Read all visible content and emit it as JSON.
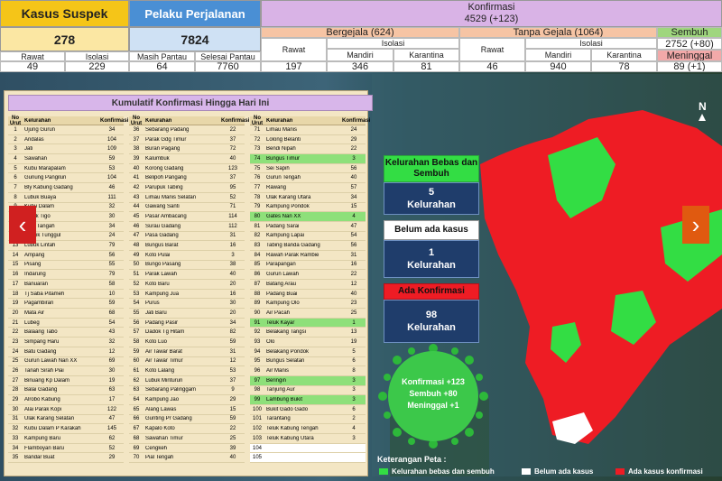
{
  "top": {
    "suspek": {
      "title": "Kasus Suspek",
      "total": "278",
      "rawat_label": "Rawat",
      "isolasi_label": "Isolasi",
      "rawat": "49",
      "isolasi": "229"
    },
    "perjalanan": {
      "title": "Pelaku Perjalanan",
      "total": "7824",
      "masih_label": "Masih Pantau",
      "selesai_label": "Selesai Pantau",
      "masih": "64",
      "selesai": "7760"
    },
    "konfirmasi": {
      "title": "Konfirmasi",
      "total": "4529 (+123)",
      "bergejala": {
        "title": "Bergejala (624)",
        "rawat_label": "Rawat",
        "isolasi_label": "Isolasi",
        "mandiri_label": "Mandiri",
        "karantina_label": "Karantina",
        "rawat": "197",
        "mandiri": "346",
        "karantina": "81"
      },
      "tanpa_gejala": {
        "title": "Tanpa Gejala (1064)",
        "rawat_label": "Rawat",
        "isolasi_label": "Isolasi",
        "mandiri_label": "Mandiri",
        "karantina_label": "Karantina",
        "rawat": "46",
        "mandiri": "940",
        "karantina": "78"
      },
      "sembuh_label": "Sembuh",
      "sembuh": "2752 (+80)",
      "meninggal_label": "Meninggal",
      "meninggal": "89 (+1)"
    }
  },
  "list": {
    "title": "Kumulatif Konfirmasi Hingga Hari Ini",
    "col_no": "No Urut",
    "col_name": "Kelurahan",
    "col_val": "Konfirmasi",
    "columns": [
      [
        {
          "no": "1",
          "name": "Ujung Gurun",
          "val": "34",
          "hl": ""
        },
        {
          "no": "2",
          "name": "Andalas",
          "val": "104",
          "hl": ""
        },
        {
          "no": "3",
          "name": "Jati",
          "val": "109",
          "hl": ""
        },
        {
          "no": "4",
          "name": "Sawahan",
          "val": "59",
          "hl": ""
        },
        {
          "no": "5",
          "name": "Kubu Marapalam",
          "val": "53",
          "hl": ""
        },
        {
          "no": "6",
          "name": "Gunung Pangilun",
          "val": "104",
          "hl": ""
        },
        {
          "no": "7",
          "name": "Bly Kabung Gadang",
          "val": "46",
          "hl": ""
        },
        {
          "no": "8",
          "name": "Lubuk Buaya",
          "val": "111",
          "hl": ""
        },
        {
          "no": "9",
          "name": "Kubu Dalam",
          "val": "32",
          "hl": ""
        },
        {
          "no": "10",
          "name": "Parak Tigo",
          "val": "30",
          "hl": ""
        },
        {
          "no": "11",
          "name": "Koto Tangah",
          "val": "34",
          "hl": ""
        },
        {
          "no": "12",
          "name": "Dadok Tunggul",
          "val": "24",
          "hl": ""
        },
        {
          "no": "13",
          "name": "Lubuk Lintah",
          "val": "79",
          "hl": ""
        },
        {
          "no": "14",
          "name": "Ampang",
          "val": "56",
          "hl": ""
        },
        {
          "no": "15",
          "name": "Pisang",
          "val": "55",
          "hl": ""
        },
        {
          "no": "16",
          "name": "Indarung",
          "val": "79",
          "hl": ""
        },
        {
          "no": "17",
          "name": "Banuaran",
          "val": "58",
          "hl": ""
        },
        {
          "no": "18",
          "name": "Tj Saba Pitameh",
          "val": "10",
          "hl": ""
        },
        {
          "no": "19",
          "name": "Pagambiran",
          "val": "59",
          "hl": ""
        },
        {
          "no": "20",
          "name": "Mata Air",
          "val": "68",
          "hl": ""
        },
        {
          "no": "21",
          "name": "Lubeg",
          "val": "54",
          "hl": ""
        },
        {
          "no": "22",
          "name": "Balaang Tabo",
          "val": "43",
          "hl": ""
        },
        {
          "no": "23",
          "name": "Simpang Haru",
          "val": "32",
          "hl": ""
        },
        {
          "no": "24",
          "name": "Batu Gadang",
          "val": "12",
          "hl": ""
        },
        {
          "no": "25",
          "name": "Gurun Lawah Nan XX",
          "val": "69",
          "hl": ""
        },
        {
          "no": "26",
          "name": "Tanah Sirah Piai",
          "val": "30",
          "hl": ""
        },
        {
          "no": "27",
          "name": "Binuang Kp Dalam",
          "val": "19",
          "hl": ""
        },
        {
          "no": "28",
          "name": "Balai Gadang",
          "val": "63",
          "hl": ""
        },
        {
          "no": "29",
          "name": "Alrobo Kabung",
          "val": "17",
          "hl": ""
        },
        {
          "no": "30",
          "name": "Alai Parak Kopi",
          "val": "122",
          "hl": ""
        },
        {
          "no": "31",
          "name": "Ulak Karang Selatan",
          "val": "47",
          "hl": ""
        },
        {
          "no": "32",
          "name": "Kubu Dalam P Karakah",
          "val": "145",
          "hl": ""
        },
        {
          "no": "33",
          "name": "Kampung Baru",
          "val": "62",
          "hl": ""
        },
        {
          "no": "34",
          "name": "Flamboyan Baru",
          "val": "52",
          "hl": ""
        },
        {
          "no": "35",
          "name": "Bandar Buat",
          "val": "29",
          "hl": ""
        }
      ],
      [
        {
          "no": "36",
          "name": "Sebarang Padang",
          "val": "22",
          "hl": ""
        },
        {
          "no": "37",
          "name": "Parak Gdg Timur",
          "val": "37",
          "hl": ""
        },
        {
          "no": "38",
          "name": "Buran Pagang",
          "val": "72",
          "hl": ""
        },
        {
          "no": "39",
          "name": "Kalumbuk",
          "val": "40",
          "hl": ""
        },
        {
          "no": "40",
          "name": "Korong Gadang",
          "val": "123",
          "hl": ""
        },
        {
          "no": "41",
          "name": "Belipoh Pangang",
          "val": "37",
          "hl": ""
        },
        {
          "no": "42",
          "name": "Parupuk Tabing",
          "val": "95",
          "hl": ""
        },
        {
          "no": "43",
          "name": "Limau Manis Selatan",
          "val": "52",
          "hl": ""
        },
        {
          "no": "44",
          "name": "Gawang Santi",
          "val": "71",
          "hl": ""
        },
        {
          "no": "45",
          "name": "Pasar Ambacang",
          "val": "114",
          "hl": ""
        },
        {
          "no": "46",
          "name": "Surau Gadang",
          "val": "112",
          "hl": ""
        },
        {
          "no": "47",
          "name": "Pasa Gadang",
          "val": "31",
          "hl": ""
        },
        {
          "no": "48",
          "name": "Bungus Barat",
          "val": "16",
          "hl": ""
        },
        {
          "no": "49",
          "name": "Koto Pulai",
          "val": "3",
          "hl": ""
        },
        {
          "no": "50",
          "name": "Bungo Pasang",
          "val": "38",
          "hl": ""
        },
        {
          "no": "51",
          "name": "Parak Lawah",
          "val": "40",
          "hl": ""
        },
        {
          "no": "52",
          "name": "Koto Baru",
          "val": "20",
          "hl": ""
        },
        {
          "no": "53",
          "name": "Kampung Jua",
          "val": "16",
          "hl": ""
        },
        {
          "no": "54",
          "name": "Purus",
          "val": "30",
          "hl": ""
        },
        {
          "no": "55",
          "name": "Jati Baru",
          "val": "20",
          "hl": ""
        },
        {
          "no": "56",
          "name": "Padang Pasir",
          "val": "34",
          "hl": ""
        },
        {
          "no": "57",
          "name": "Dadok Tg Hitam",
          "val": "82",
          "hl": ""
        },
        {
          "no": "58",
          "name": "Koto Luo",
          "val": "59",
          "hl": ""
        },
        {
          "no": "59",
          "name": "Air Tawar Barat",
          "val": "31",
          "hl": ""
        },
        {
          "no": "60",
          "name": "Air Tawar Timur",
          "val": "12",
          "hl": ""
        },
        {
          "no": "61",
          "name": "Koto Lalang",
          "val": "53",
          "hl": ""
        },
        {
          "no": "62",
          "name": "Lubuk Minturun",
          "val": "37",
          "hl": ""
        },
        {
          "no": "63",
          "name": "Sebarang Palinggam",
          "val": "9",
          "hl": ""
        },
        {
          "no": "64",
          "name": "Kampung Jao",
          "val": "29",
          "hl": ""
        },
        {
          "no": "65",
          "name": "Alang Lawas",
          "val": "15",
          "hl": ""
        },
        {
          "no": "66",
          "name": "Gunting Pr Gadang",
          "val": "59",
          "hl": ""
        },
        {
          "no": "67",
          "name": "Kapalo Koto",
          "val": "22",
          "hl": ""
        },
        {
          "no": "68",
          "name": "Sawahan Timur",
          "val": "25",
          "hl": ""
        },
        {
          "no": "69",
          "name": "Cengkeh",
          "val": "39",
          "hl": ""
        },
        {
          "no": "70",
          "name": "Pial Tengah",
          "val": "40",
          "hl": ""
        }
      ],
      [
        {
          "no": "71",
          "name": "Limau Manis",
          "val": "24",
          "hl": ""
        },
        {
          "no": "72",
          "name": "Lolong Belanti",
          "val": "29",
          "hl": ""
        },
        {
          "no": "73",
          "name": "Bendi Nipah",
          "val": "22",
          "hl": ""
        },
        {
          "no": "74",
          "name": "Bungus Timur",
          "val": "3",
          "hl": "g"
        },
        {
          "no": "75",
          "name": "Sei Sapih",
          "val": "56",
          "hl": ""
        },
        {
          "no": "76",
          "name": "Gurun Tengah",
          "val": "40",
          "hl": ""
        },
        {
          "no": "77",
          "name": "Rawang",
          "val": "57",
          "hl": ""
        },
        {
          "no": "78",
          "name": "Ulak Karang Utara",
          "val": "34",
          "hl": ""
        },
        {
          "no": "79",
          "name": "Kampung Pondok",
          "val": "15",
          "hl": ""
        },
        {
          "no": "80",
          "name": "Gates Nan XX",
          "val": "4",
          "hl": "g"
        },
        {
          "no": "81",
          "name": "Padang Sarai",
          "val": "47",
          "hl": ""
        },
        {
          "no": "82",
          "name": "Kampung Lapai",
          "val": "54",
          "hl": ""
        },
        {
          "no": "83",
          "name": "Tabing Banda Gadang",
          "val": "56",
          "hl": ""
        },
        {
          "no": "84",
          "name": "Rawah Parak Rambie",
          "val": "31",
          "hl": ""
        },
        {
          "no": "85",
          "name": "Parapangan",
          "val": "16",
          "hl": ""
        },
        {
          "no": "86",
          "name": "Gurun Lawah",
          "val": "22",
          "hl": ""
        },
        {
          "no": "87",
          "name": "Batang Arau",
          "val": "12",
          "hl": ""
        },
        {
          "no": "88",
          "name": "Padang Buai",
          "val": "40",
          "hl": ""
        },
        {
          "no": "89",
          "name": "Kampung Olo",
          "val": "23",
          "hl": ""
        },
        {
          "no": "90",
          "name": "Air Pacah",
          "val": "25",
          "hl": ""
        },
        {
          "no": "91",
          "name": "Teluk Kayar",
          "val": "1",
          "hl": "g"
        },
        {
          "no": "92",
          "name": "Belakang Tangsi",
          "val": "13",
          "hl": ""
        },
        {
          "no": "93",
          "name": "Olo",
          "val": "19",
          "hl": ""
        },
        {
          "no": "94",
          "name": "Belakang Pondok",
          "val": "5",
          "hl": ""
        },
        {
          "no": "95",
          "name": "Bungus Selatan",
          "val": "6",
          "hl": ""
        },
        {
          "no": "96",
          "name": "Air Manis",
          "val": "8",
          "hl": ""
        },
        {
          "no": "97",
          "name": "Beringin",
          "val": "3",
          "hl": "g"
        },
        {
          "no": "98",
          "name": "Tanjung Aur",
          "val": "3",
          "hl": ""
        },
        {
          "no": "99",
          "name": "Lambung Bukit",
          "val": "3",
          "hl": "g"
        },
        {
          "no": "100",
          "name": "Bukit Gado Gado",
          "val": "6",
          "hl": ""
        },
        {
          "no": "101",
          "name": "Tarantang",
          "val": "2",
          "hl": ""
        },
        {
          "no": "102",
          "name": "Teluk Kabung Tengah",
          "val": "4",
          "hl": ""
        },
        {
          "no": "103",
          "name": "Teluk Kabung Utara",
          "val": "3",
          "hl": ""
        },
        {
          "no": "104",
          "name": "",
          "val": "",
          "hl": "w"
        },
        {
          "no": "105",
          "name": "",
          "val": "",
          "hl": "w"
        }
      ]
    ]
  },
  "map": {
    "box1_title": "Kelurahan Bebas dan Sembuh",
    "box1_num": "5",
    "box1_unit": "Kelurahan",
    "box2_title": "Belum ada kasus",
    "box2_num": "1",
    "box2_unit": "Kelurahan",
    "box3_title": "Ada Konfirmasi",
    "box3_num": "98",
    "box3_unit": "Kelurahan",
    "virus_line1": "Konfirmasi +123",
    "virus_line2": "Sembuh +80",
    "virus_line3": "Meninggal +1",
    "north": "N",
    "legend_title": "Keterangan Peta :",
    "legend_green": "Kelurahan bebas dan sembuh",
    "legend_white": "Belum ada kasus",
    "legend_red": "Ada kasus konfirmasi"
  },
  "colors": {
    "green": "#33dd44",
    "red": "#ee1c24",
    "white": "#ffffff",
    "accent": "#d9b3e6"
  },
  "icons": {
    "prev": "chevron-left-icon",
    "next": "chevron-right-icon"
  }
}
